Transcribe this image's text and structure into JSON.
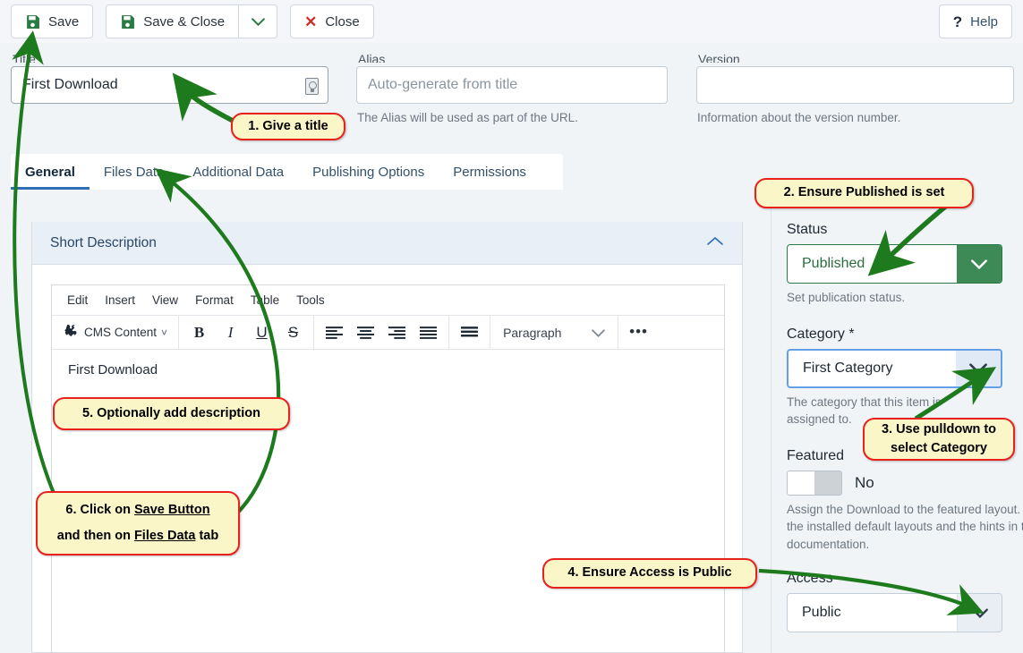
{
  "toolbar": {
    "save_label": "Save",
    "save_close_label": "Save & Close",
    "close_label": "Close",
    "help_label": "Help",
    "dropdown_icon": "chevron-down-icon",
    "save_icon": "floppy-disk-icon",
    "close_icon": "x-icon",
    "help_icon": "question-mark-icon"
  },
  "fields": {
    "title": {
      "label": "Title",
      "value": "First Download",
      "badge_icon": "article-indicator-icon"
    },
    "alias": {
      "label": "Alias",
      "placeholder": "Auto-generate from title",
      "hint": "The Alias will be used as part of the URL."
    },
    "version": {
      "label": "Version",
      "value": "",
      "hint": "Information about the version number."
    }
  },
  "tabs": [
    {
      "label": "General",
      "active": true
    },
    {
      "label": "Files Data",
      "active": false
    },
    {
      "label": "Additional Data",
      "active": false
    },
    {
      "label": "Publishing Options",
      "active": false
    },
    {
      "label": "Permissions",
      "active": false
    }
  ],
  "panel": {
    "title": "Short Description",
    "collapse_icon": "chevron-up-icon"
  },
  "editor": {
    "menubar": [
      "Edit",
      "Insert",
      "View",
      "Format",
      "Table",
      "Tools"
    ],
    "cms_content_label": "CMS Content",
    "cms_logo_icon": "joomla-logo-icon",
    "bold": "B",
    "italic": "I",
    "underline": "U",
    "strike": "S",
    "align_left_icon": "align-left-icon",
    "align_center_icon": "align-center-icon",
    "align_right_icon": "align-right-icon",
    "align_justify_icon": "align-justify-icon",
    "list_icon": "bullet-list-icon",
    "format_label": "Paragraph",
    "more_icon": "ellipsis-icon",
    "content": "First Download"
  },
  "sidebar": {
    "status": {
      "label": "Status",
      "value": "Published",
      "hint": "Set publication status.",
      "arrow_icon": "chevron-down-icon",
      "accent": "#3d8a57"
    },
    "category": {
      "label": "Category *",
      "value": "First Category",
      "hint": "The category that this item is assigned to.",
      "arrow_icon": "chevron-down-icon",
      "accent": "#62a0e8"
    },
    "featured": {
      "label": "Featured",
      "value": "No",
      "hint": "Assign the Download to the featured layout. See the installed default layouts and the hints in the documentation."
    },
    "access": {
      "label": "Access",
      "value": "Public",
      "arrow_icon": "chevron-down-icon"
    }
  },
  "callouts": [
    {
      "id": 1,
      "text": "1. Give a title"
    },
    {
      "id": 2,
      "text": "2. Ensure Published is set"
    },
    {
      "id": 3,
      "text": "3. Use pulldown to select Category"
    },
    {
      "id": 4,
      "text": "4. Ensure Access is Public"
    },
    {
      "id": 5,
      "text": "5. Optionally add description"
    },
    {
      "id": 6,
      "line1_pre": "6. Click on ",
      "line1_underline": "Save Button",
      "line2_pre": "and then on ",
      "line2_underline": "Files Data",
      "line2_post": " tab"
    }
  ],
  "colors": {
    "callout_bg": "#fbf6c8",
    "callout_border": "#e8211c",
    "arrow_green": "#1d7a1d",
    "tab_active": "#2f6fb5"
  }
}
